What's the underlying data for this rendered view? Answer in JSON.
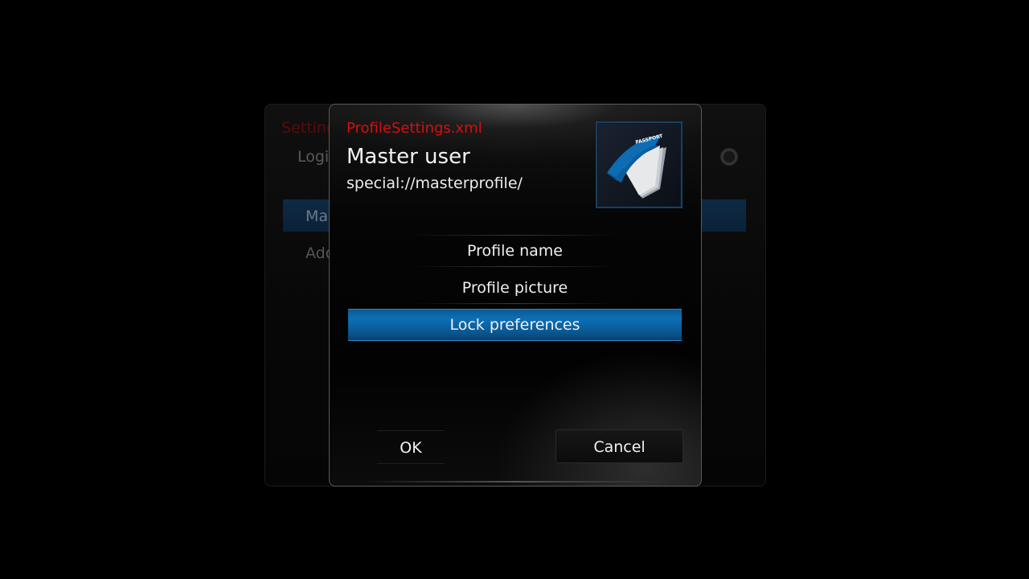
{
  "background": {
    "title": "Settings - Profiles",
    "login_label": "Login screen",
    "list_items": [
      "Master user",
      "Add profile..."
    ]
  },
  "dialog": {
    "filename": "ProfileSettings.xml",
    "title": "Master user",
    "path": "special://masterprofile/",
    "thumbnail_icon": "passport-icon",
    "menu_items": [
      "Profile name",
      "Profile picture",
      "Lock preferences"
    ],
    "selected_index": 2,
    "ok_label": "OK",
    "cancel_label": "Cancel"
  },
  "colors": {
    "accent_blue": "#0d6fb6",
    "filename_red": "#d60f0f"
  }
}
